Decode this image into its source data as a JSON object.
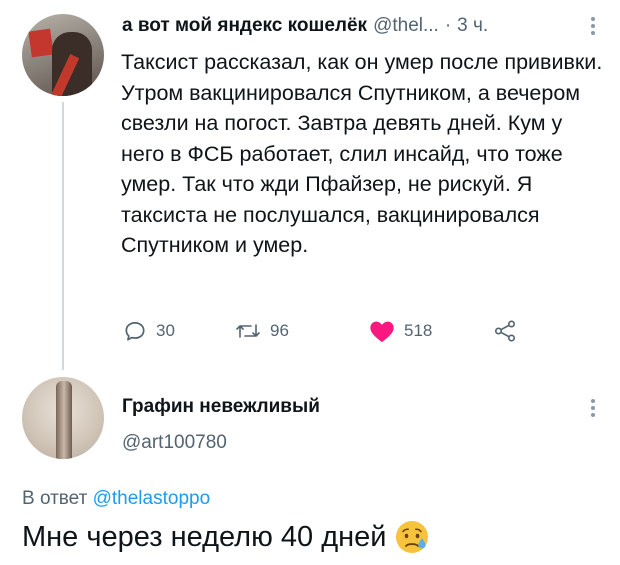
{
  "tweet": {
    "author_name": "а вот мой яндекс кошелёк",
    "author_handle": "@thel...",
    "separator": "·",
    "time": "3 ч.",
    "text": "Таксист рассказал, как он умер после прививки. Утром вакцинировался Спутником, а вечером свезли на погост. Завтра девять дней. Кум у него в ФСБ работает, слил инсайд, что тоже умер. Так что жди Пфайзер, не рискуй. Я таксиста не послушался, вакцинировался Спутником и умер.",
    "replies": "30",
    "retweets": "96",
    "likes": "518",
    "like_color": "#f91880",
    "icons": [
      "comment-icon",
      "retweet-icon",
      "heart-icon",
      "share-icon",
      "more-icon"
    ]
  },
  "reply": {
    "author_name": "Графин невежливый",
    "author_handle": "@art100780",
    "reply_prefix": "В ответ",
    "reply_mention": "@thelastoppo",
    "text": "Мне через неделю 40 дней",
    "emoji": "sad-but-relieved-face",
    "mention_color": "#1d9bf0"
  }
}
